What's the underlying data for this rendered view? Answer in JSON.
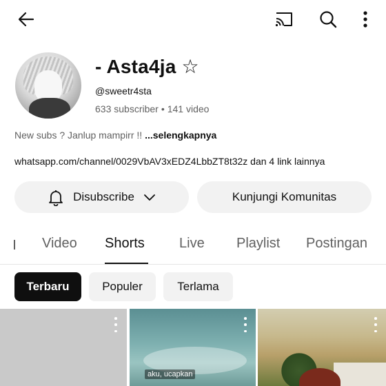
{
  "topbar": {
    "back_icon": "arrow-left-icon",
    "cast_icon": "cast-icon",
    "search_icon": "search-icon",
    "more_icon": "more-vertical-icon"
  },
  "channel": {
    "name": "- Asta4ja ☆",
    "handle": "@sweetr4sta",
    "subscribers": "633 subscriber",
    "separator": "•",
    "videos": "141 video",
    "description": "New subs ? Janlup mampirr !! ",
    "description_more": "...selengkapnya",
    "links": "whatsapp.com/channel/0029VbAV3xEDZ4LbbZT8t32z dan 4 link lainnya"
  },
  "actions": {
    "subscribe_label": "Disubscribe",
    "community_label": "Kunjungi Komunitas"
  },
  "tabs": [
    {
      "label": "Video"
    },
    {
      "label": "Shorts",
      "active": true
    },
    {
      "label": "Live"
    },
    {
      "label": "Playlist"
    },
    {
      "label": "Postingan"
    }
  ],
  "chips": [
    {
      "label": "Terbaru",
      "active": true
    },
    {
      "label": "Populer"
    },
    {
      "label": "Terlama"
    }
  ],
  "shorts": [
    {
      "caption": ""
    },
    {
      "caption": "aku, ucapkan"
    },
    {
      "caption": ""
    }
  ]
}
